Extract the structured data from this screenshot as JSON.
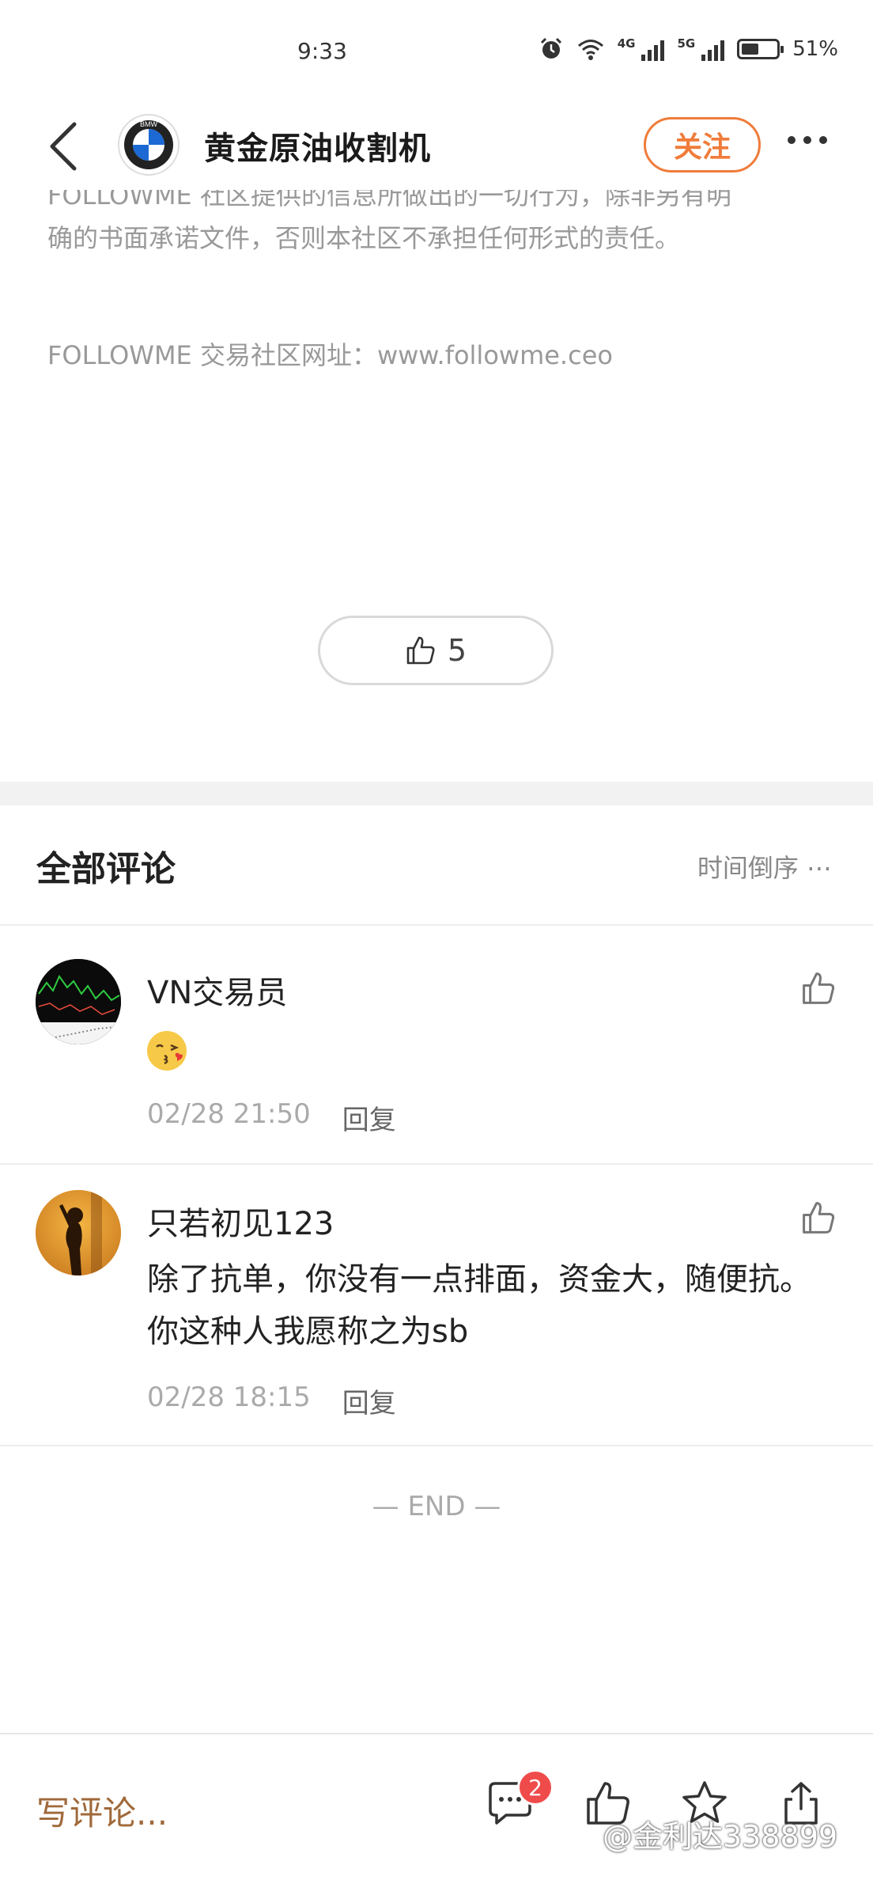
{
  "status_bar": {
    "time": "9:33",
    "network_1": "4G",
    "network_2": "5G",
    "battery": "51%",
    "battery_level": 0.51
  },
  "header": {
    "account_name": "黄金原油收割机",
    "logo_letters": "BMW",
    "follow_label": "关注"
  },
  "article": {
    "disclaimer_cut_line": "FOLLOWME 社区提供的信息所做出的一切行为，除非另有明",
    "disclaimer_line": "确的书面承诺文件，否则本社区不承担任何形式的责任。",
    "website_line": "FOLLOWME 交易社区网址：www.followme.ceo",
    "like_count": "5"
  },
  "comments": {
    "title": "全部评论",
    "sort_label": "时间倒序",
    "items": [
      {
        "user": "VN交易员",
        "text": "",
        "emoji": "kissing-face-emoji",
        "time": "02/28 21:50",
        "reply_label": "回复"
      },
      {
        "user": "只若初见123",
        "text": "除了抗单，你没有一点排面，资金大，随便抗。你这种人我愿称之为sb",
        "time": "02/28 18:15",
        "reply_label": "回复"
      }
    ],
    "end_label": "— END —"
  },
  "bottom_bar": {
    "write_placeholder": "写评论...",
    "comment_badge": "2",
    "watermark": "@金利达338899"
  },
  "colors": {
    "accent": "#f07c3a",
    "write_text": "#a0693a",
    "badge": "#f04b4b"
  }
}
